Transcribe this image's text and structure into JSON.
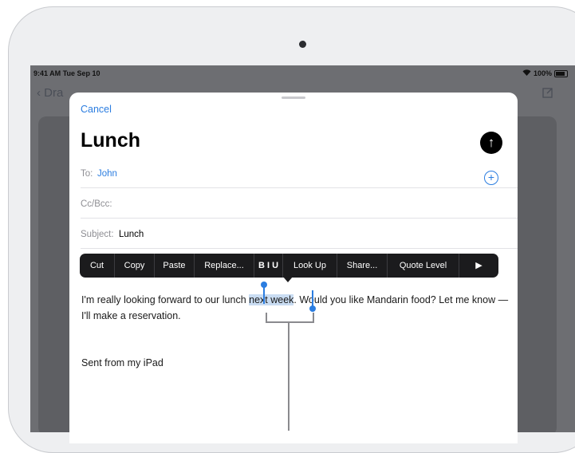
{
  "status_bar": {
    "time": "9:41 AM",
    "date": "Tue Sep 10",
    "signal_icon": "wifi-icon",
    "battery": "100%"
  },
  "background_nav": {
    "back_label": "Dra",
    "compose_icon": "compose-icon"
  },
  "compose": {
    "cancel_label": "Cancel",
    "title": "Lunch",
    "send_icon": "arrow-up-icon",
    "to_label": "To:",
    "to_value": "John",
    "cc_label": "Cc/Bcc:",
    "subject_label": "Subject:",
    "subject_value": "Lunch",
    "add_icon": "plus-circle-icon"
  },
  "edit_menu": {
    "items": [
      "Cut",
      "Copy",
      "Paste",
      "Replace...",
      "B I U",
      "Look Up",
      "Share...",
      "Quote Level",
      "▶"
    ]
  },
  "body": {
    "text_before": "I'm really looking forward to our lunch ",
    "selected_text": "next week",
    "text_after": ". Would you like Mandarin food? Let me know — I'll make a reservation.",
    "signature": "Sent from my iPad"
  },
  "colors": {
    "accent": "#2b7de0",
    "selection": "#c9dcf2",
    "menu_bg": "#1b1b1d"
  }
}
